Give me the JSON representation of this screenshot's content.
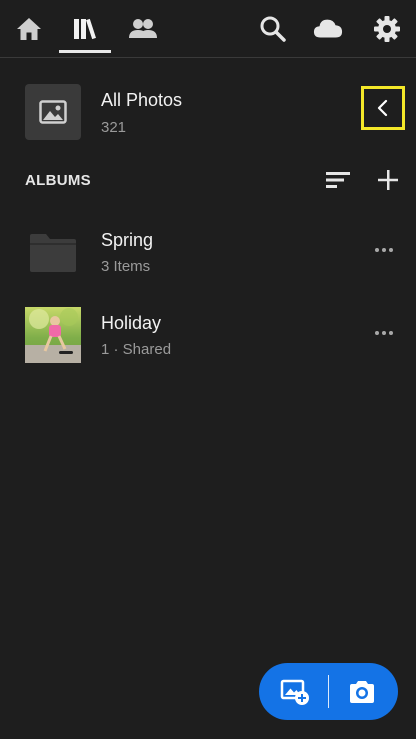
{
  "nav": {
    "items": [
      {
        "icon": "home-icon"
      },
      {
        "icon": "library-icon",
        "active": true
      },
      {
        "icon": "people-icon"
      },
      {
        "icon": "search-icon"
      },
      {
        "icon": "cloud-icon"
      },
      {
        "icon": "gear-icon"
      }
    ]
  },
  "all_photos": {
    "title": "All Photos",
    "count": "321"
  },
  "albums": {
    "header": "ALBUMS",
    "items": [
      {
        "name": "Spring",
        "subtitle": "3 Items",
        "thumb": "folder-icon"
      },
      {
        "name": "Holiday",
        "subtitle": "1 · Shared",
        "thumb": "photo-thumbnail"
      }
    ]
  },
  "fab": {
    "import_icon": "add-photo-icon",
    "camera_icon": "camera-icon"
  },
  "colors": {
    "background": "#1e1e1e",
    "accent": "#1473e6",
    "highlight": "#f4e829"
  }
}
